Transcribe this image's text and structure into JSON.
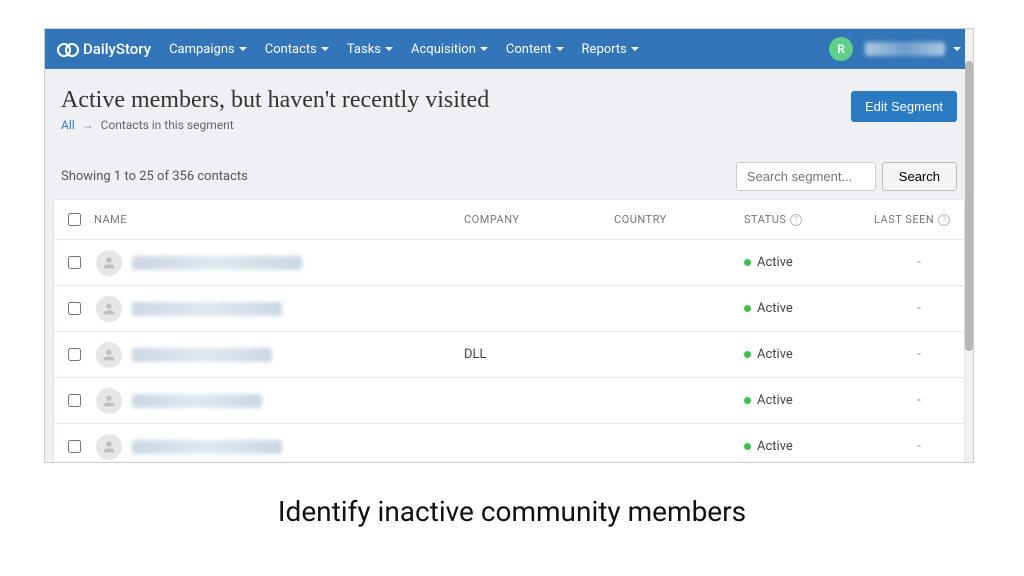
{
  "brand": "DailyStory",
  "nav": {
    "items": [
      {
        "label": "Campaigns"
      },
      {
        "label": "Contacts"
      },
      {
        "label": "Tasks"
      },
      {
        "label": "Acquisition"
      },
      {
        "label": "Content"
      },
      {
        "label": "Reports"
      }
    ],
    "user_initial": "R"
  },
  "header": {
    "title": "Active members, but haven't recently visited",
    "breadcrumb_all": "All",
    "breadcrumb_current": "Contacts in this segment",
    "edit_label": "Edit Segment"
  },
  "toolbar": {
    "showing_text": "Showing 1 to 25 of 356 contacts",
    "search_placeholder": "Search segment...",
    "search_button": "Search"
  },
  "columns": {
    "name": "NAME",
    "company": "COMPANY",
    "country": "COUNTRY",
    "status": "STATUS",
    "last_seen": "LAST SEEN"
  },
  "rows": [
    {
      "name_blur_width": 170,
      "company": "",
      "country": "",
      "status": "Active",
      "last_seen": "-"
    },
    {
      "name_blur_width": 150,
      "company": "",
      "country": "",
      "status": "Active",
      "last_seen": "-"
    },
    {
      "name_blur_width": 140,
      "company": "DLL",
      "country": "",
      "status": "Active",
      "last_seen": "-"
    },
    {
      "name_blur_width": 130,
      "company": "",
      "country": "",
      "status": "Active",
      "last_seen": "-"
    },
    {
      "name_blur_width": 150,
      "company": "",
      "country": "",
      "status": "Active",
      "last_seen": "-"
    }
  ],
  "caption": "Identify inactive community members"
}
